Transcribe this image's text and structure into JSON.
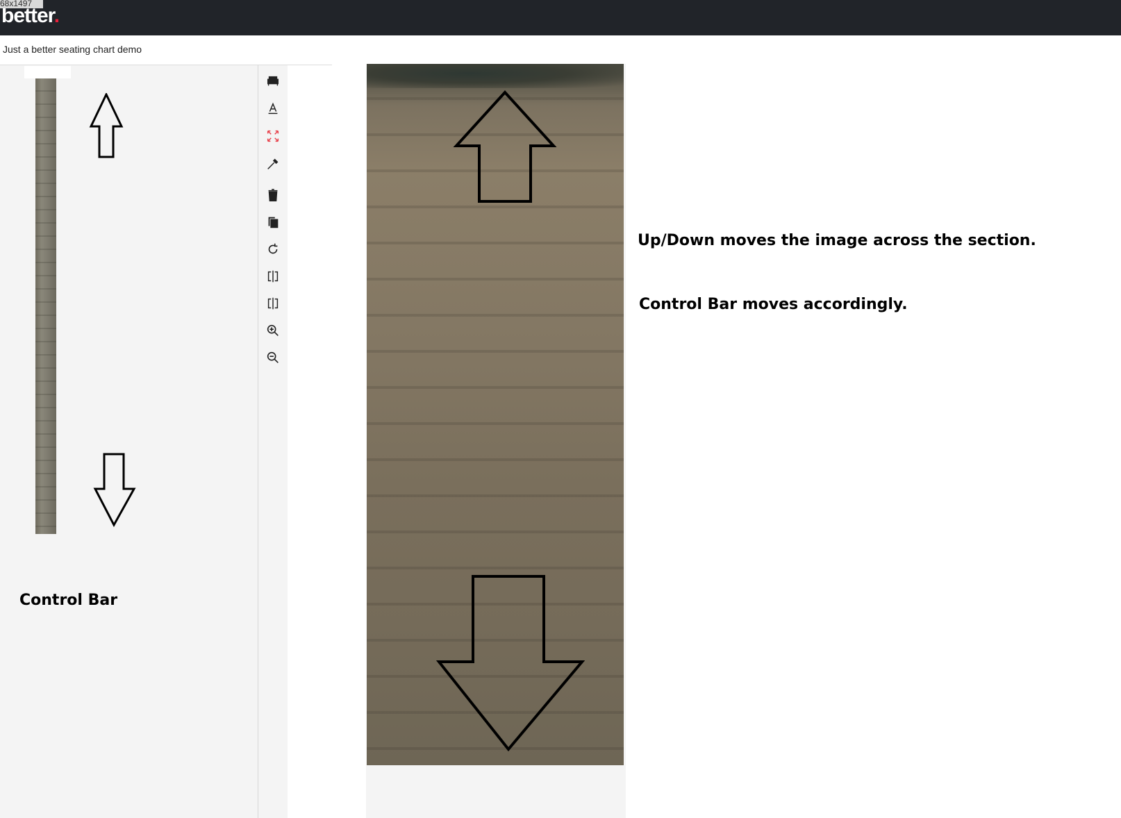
{
  "header": {
    "dimension_label": "68x1497",
    "logo_text": "better",
    "logo_dot": "."
  },
  "subbar": {
    "title": "Just a better seating chart demo"
  },
  "toolbar": {
    "tools": [
      {
        "name": "seat-icon"
      },
      {
        "name": "text-icon"
      },
      {
        "name": "expand-icon"
      },
      {
        "name": "eyedropper-icon"
      },
      {
        "name": "trash-icon"
      },
      {
        "name": "copy-icon"
      },
      {
        "name": "rotate-icon"
      },
      {
        "name": "flip-horizontal-icon"
      },
      {
        "name": "flip-vertical-icon"
      },
      {
        "name": "zoom-in-icon"
      },
      {
        "name": "zoom-out-icon"
      }
    ]
  },
  "annotations": {
    "control_bar_label": "Control Bar",
    "note_1": "Up/Down moves the image across the section.",
    "note_2": "Control Bar moves accordingly."
  },
  "colors": {
    "header_bg": "#212429",
    "logo_accent": "#e8203a",
    "panel_bg": "#f4f4f4"
  }
}
